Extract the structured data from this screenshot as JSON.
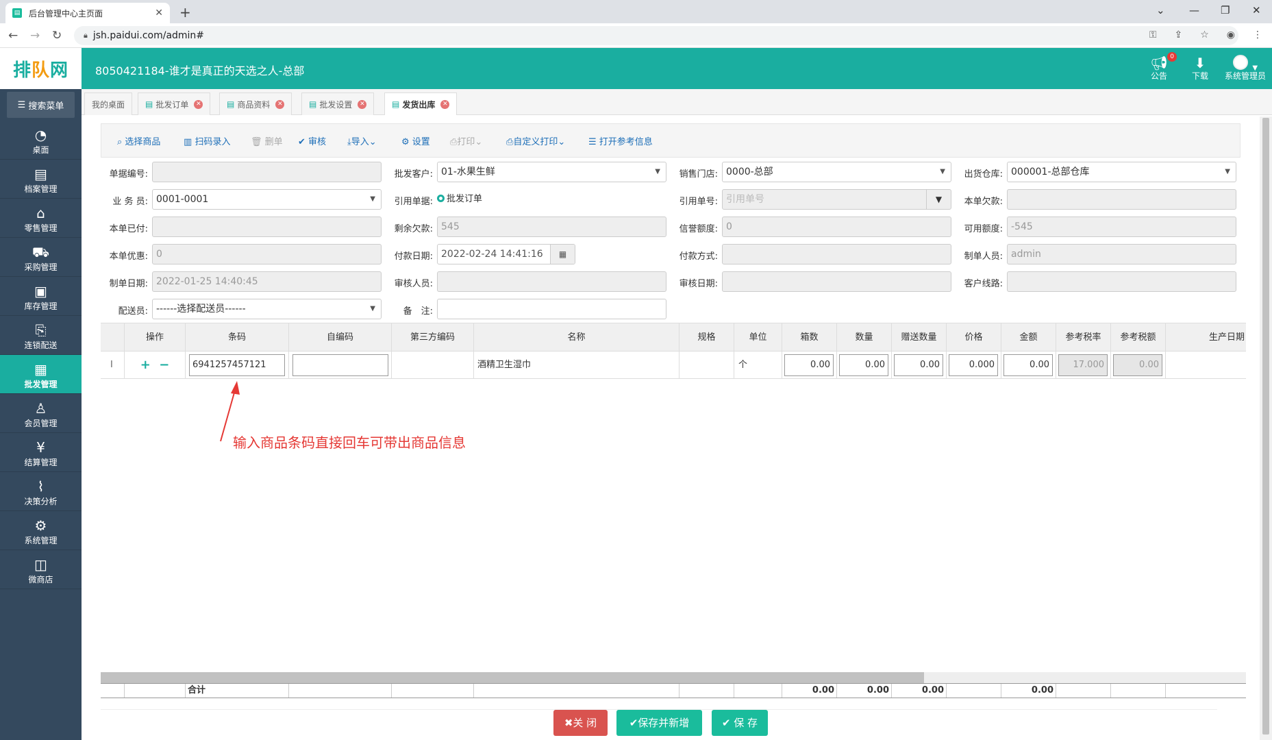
{
  "browser": {
    "tab_title": "后台管理中心主页面",
    "url": "jsh.paidui.com/admin#"
  },
  "app": {
    "logo_main": "排",
    "logo_mid": "队",
    "logo_end": "网",
    "title": "8050421184-谁才是真正的天选之人-总部",
    "notice_label": "公告",
    "notice_count": "0",
    "download_label": "下载",
    "user_label": "系统管理员"
  },
  "sidebar": {
    "search_label": "搜索菜单",
    "items": [
      {
        "label": "桌面",
        "icon": "◔"
      },
      {
        "label": "档案管理",
        "icon": "▤"
      },
      {
        "label": "零售管理",
        "icon": "⌂"
      },
      {
        "label": "采购管理",
        "icon": "⛟"
      },
      {
        "label": "库存管理",
        "icon": "▣"
      },
      {
        "label": "连锁配送",
        "icon": "⎘"
      },
      {
        "label": "批发管理",
        "icon": "▦"
      },
      {
        "label": "会员管理",
        "icon": "♙"
      },
      {
        "label": "结算管理",
        "icon": "¥"
      },
      {
        "label": "决策分析",
        "icon": "⌇"
      },
      {
        "label": "系统管理",
        "icon": "⚙"
      },
      {
        "label": "微商店",
        "icon": "◫"
      }
    ]
  },
  "page_tabs": [
    {
      "label": "我的桌面"
    },
    {
      "label": "批发订单"
    },
    {
      "label": "商品资料"
    },
    {
      "label": "批发设置"
    },
    {
      "label": "发货出库"
    }
  ],
  "toolbar": {
    "select_goods": "选择商品",
    "scan_input": "扫码录入",
    "delete_row": "删单",
    "audit": "审核",
    "import": "导入",
    "settings": "设置",
    "print": "打印",
    "custom_print": "自定义打印",
    "open_ref": "打开参考信息"
  },
  "form": {
    "doc_no_label": "单据编号:",
    "doc_no": "",
    "customer_label": "批发客户:",
    "customer": "01-水果生鲜",
    "store_label": "销售门店:",
    "store": "0000-总部",
    "warehouse_label": "出货仓库:",
    "warehouse": "000001-总部仓库",
    "salesman_label": "业 务 员:",
    "salesman": "0001-0001",
    "ref_doc_label": "引用单据:",
    "ref_doc_option": "批发订单",
    "ref_no_label": "引用单号:",
    "ref_no_placeholder": "引用单号",
    "owed_label": "本单欠款:",
    "owed": "",
    "paid_label": "本单已付:",
    "paid": "",
    "remaining_label": "剩余欠款:",
    "remaining": "545",
    "credit_label": "信誉额度:",
    "credit": "0",
    "available_label": "可用额度:",
    "available": "-545",
    "discount_label": "本单优惠:",
    "discount": "0",
    "pay_date_label": "付款日期:",
    "pay_date": "2022-02-24 14:41:16",
    "pay_method_label": "付款方式:",
    "pay_method": "",
    "creator_label": "制单人员:",
    "creator": "admin",
    "create_date_label": "制单日期:",
    "create_date": "2022-01-25 14:40:45",
    "auditor_label": "审核人员:",
    "auditor": "",
    "audit_date_label": "审核日期:",
    "audit_date": "",
    "route_label": "客户线路:",
    "route": "",
    "deliverer_label": "配送员:",
    "deliverer": "------选择配送员------",
    "remark_label": "备　注:",
    "remark": ""
  },
  "grid": {
    "headers": [
      "操作",
      "条码",
      "自编码",
      "第三方编码",
      "名称",
      "规格",
      "单位",
      "箱数",
      "数量",
      "赠送数量",
      "价格",
      "金额",
      "参考税率",
      "参考税额",
      "生产日期"
    ],
    "row": {
      "cursor": "I",
      "barcode": "6941257457121",
      "self_code": "",
      "third_code": "",
      "name": "酒精卫生湿巾",
      "spec": "",
      "unit": "个",
      "boxes": "0.00",
      "qty": "0.00",
      "gift_qty": "0.00",
      "price": "0.000",
      "amount": "0.00",
      "tax_rate": "17.000",
      "tax_amount": "0.00"
    },
    "total_label": "合计",
    "totals": {
      "boxes": "0.00",
      "qty": "0.00",
      "gift_qty": "0.00",
      "amount": "0.00"
    }
  },
  "annotation": "输入商品条码直接回车可带出商品信息",
  "actions": {
    "close": "关 闭",
    "save_new": "保存并新增",
    "save": "保 存"
  },
  "colors": {
    "accent": "#1aaea0",
    "sidebar": "#34495e",
    "danger": "#d9534f",
    "success": "#1abc9c"
  }
}
